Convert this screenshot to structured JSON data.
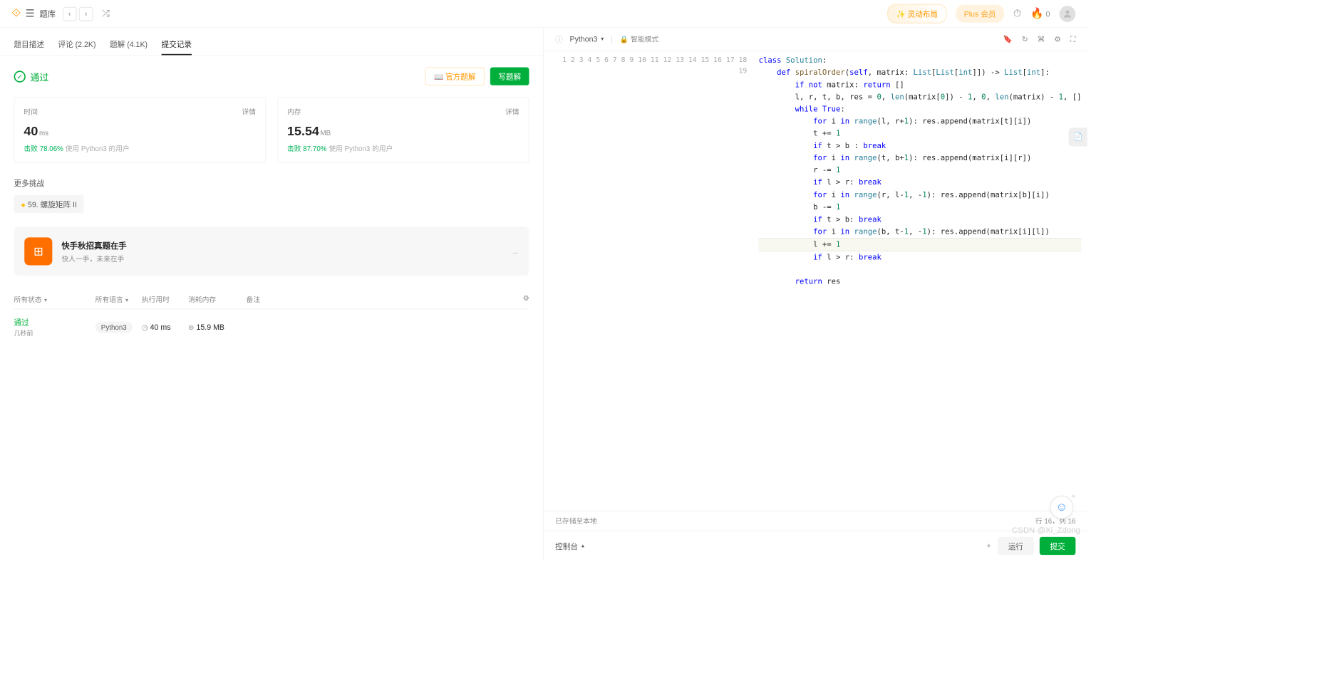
{
  "header": {
    "title": "题库",
    "floating_layout": "✨ 灵动布局",
    "plus_member": "Plus 会员",
    "fire_count": "0"
  },
  "tabs": {
    "t0": "题目描述",
    "t1": "评论 (2.2K)",
    "t2": "题解 (4.1K)",
    "t3": "提交记录"
  },
  "result": {
    "status": "通过",
    "official": "📖 官方题解",
    "write": "写题解",
    "time_label": "时间",
    "detail": "详情",
    "time_val": "40",
    "time_unit": "ms",
    "time_beat_prefix": "击败 ",
    "time_beat_pct": "78.06%",
    "time_beat_suffix": " 使用 Python3 的用户",
    "mem_label": "内存",
    "mem_val": "15.54",
    "mem_unit": "MB",
    "mem_beat_pct": "87.70%",
    "more_challenge": "更多挑战",
    "challenge_item": "59. 螺旋矩阵 II",
    "promo_title": "快手秋招真题在手",
    "promo_sub": "快人一手，未来在手"
  },
  "cols": {
    "status": "所有状态",
    "lang": "所有语言",
    "time": "执行用时",
    "mem": "消耗内存",
    "note": "备注"
  },
  "subrow": {
    "status": "通过",
    "ago": "几秒前",
    "lang": "Python3",
    "time": "40 ms",
    "mem": "15.9 MB"
  },
  "editor": {
    "lang": "Python3",
    "smart": "智能模式",
    "saved": "已存储至本地",
    "cursor": "行 16，列 16"
  },
  "bottom": {
    "console": "控制台",
    "run": "运行",
    "submit": "提交"
  },
  "watermark": "CSDN @Xi_Zdong"
}
